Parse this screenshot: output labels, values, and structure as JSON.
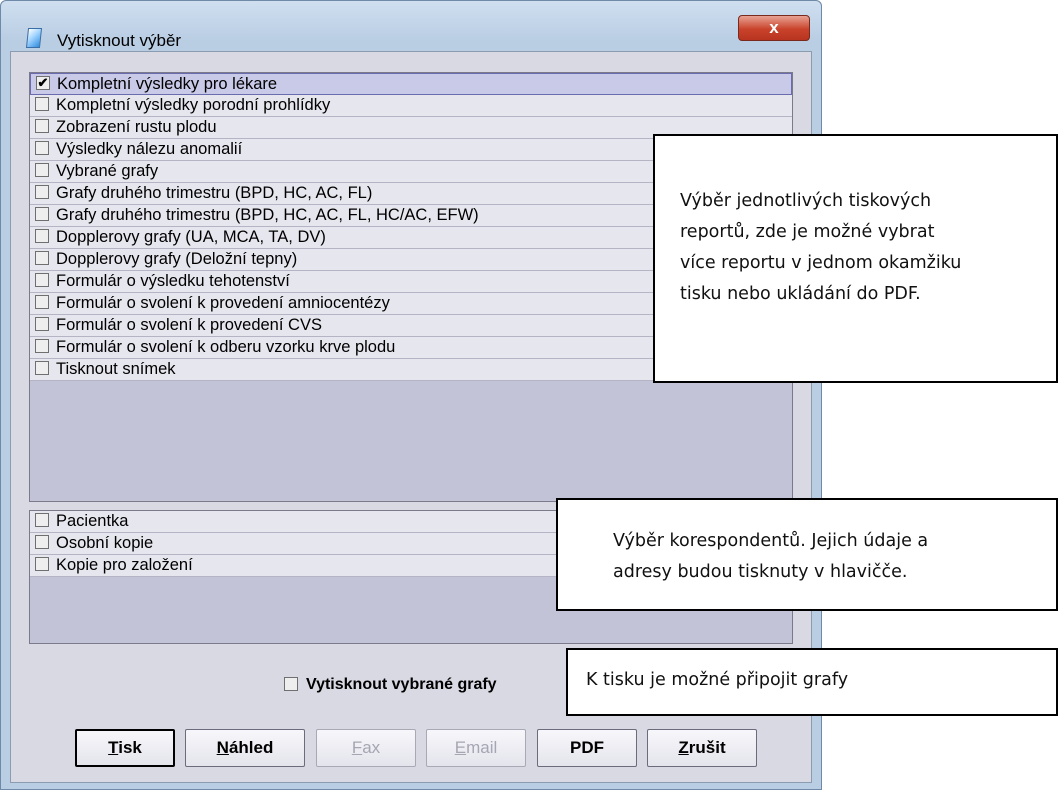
{
  "window": {
    "title": "Vytisknout výběr",
    "close_label": "x"
  },
  "reports": {
    "items": [
      {
        "label": "Kompletní výsledky pro lékare",
        "checked": true
      },
      {
        "label": "Kompletní výsledky porodní prohlídky",
        "checked": false
      },
      {
        "label": "Zobrazení rustu plodu",
        "checked": false
      },
      {
        "label": "Výsledky nálezu anomalií",
        "checked": false
      },
      {
        "label": "Vybrané grafy",
        "checked": false
      },
      {
        "label": "Grafy druhého trimestru (BPD, HC, AC, FL)",
        "checked": false
      },
      {
        "label": "Grafy druhého trimestru (BPD, HC, AC, FL, HC/AC, EFW)",
        "checked": false
      },
      {
        "label": "Dopplerovy grafy (UA, MCA, TA, DV)",
        "checked": false
      },
      {
        "label": "Dopplerovy grafy (Deložní tepny)",
        "checked": false
      },
      {
        "label": "Formulár o výsledku tehotenství",
        "checked": false
      },
      {
        "label": "Formulár o svolení k provedení amniocentézy",
        "checked": false
      },
      {
        "label": "Formulár o svolení k provedení CVS",
        "checked": false
      },
      {
        "label": "Formulár o svolení k odberu vzorku krve plodu",
        "checked": false
      },
      {
        "label": "Tisknout snímek",
        "checked": false
      }
    ]
  },
  "correspondents": {
    "items": [
      {
        "label": "Pacientka",
        "checked": false
      },
      {
        "label": "Osobní kopie",
        "checked": false
      },
      {
        "label": "Kopie pro založení",
        "checked": false
      }
    ]
  },
  "print_graphs": {
    "label": "Vytisknout vybrané grafy",
    "checked": false
  },
  "buttons": {
    "print": {
      "first": "T",
      "rest": "isk"
    },
    "preview": {
      "first": "N",
      "rest": "áhled"
    },
    "fax": {
      "first": "F",
      "rest": "ax"
    },
    "email": {
      "first": "E",
      "rest": "mail"
    },
    "pdf": {
      "label": "PDF"
    },
    "cancel": {
      "first": "Z",
      "rest": "rušit"
    }
  },
  "annotations": {
    "reports": "Výběr jednotlivých tiskových\nreportů, zde je možné vybrat\nvíce reportu v jednom okamžiku\ntisku nebo ukládání do PDF.",
    "correspondents": "Výběr korespondentů. Jejich údaje a\nadresy budou tisknuty v hlavičče.",
    "graphs": "K tisku je možné připojit grafy"
  },
  "colors": {
    "window_frame": "#b9cde3",
    "client_bg": "#d9d9e4",
    "list_bg": "#c3c3d8",
    "selected_row": "#c9c9e8",
    "close_button": "#c9432b"
  }
}
